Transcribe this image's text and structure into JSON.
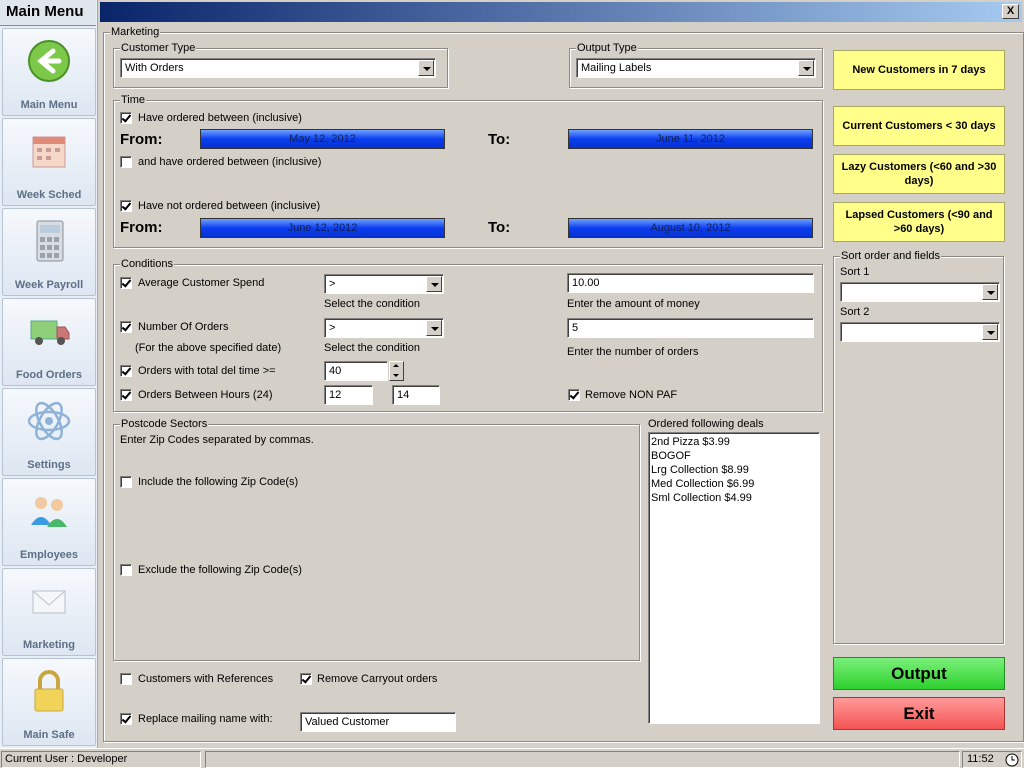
{
  "sidebar": {
    "title": "Main Menu",
    "items": [
      {
        "label": "Main Menu",
        "icon": "back-arrow-icon"
      },
      {
        "label": "Week Sched",
        "icon": "calendar-icon"
      },
      {
        "label": "Week Payroll",
        "icon": "calculator-icon"
      },
      {
        "label": "Food Orders",
        "icon": "truck-icon"
      },
      {
        "label": "Settings",
        "icon": "atom-icon"
      },
      {
        "label": "Employees",
        "icon": "people-icon"
      },
      {
        "label": "Marketing",
        "icon": "envelope-icon"
      },
      {
        "label": "Main Safe",
        "icon": "padlock-icon"
      }
    ]
  },
  "window": {
    "close_label": "X"
  },
  "marketing": {
    "label": "Marketing",
    "customer_type": {
      "label": "Customer Type",
      "value": "With Orders"
    },
    "output_type": {
      "label": "Output Type",
      "value": "Mailing Labels"
    },
    "time": {
      "label": "Time",
      "ordered_between": "Have ordered between (inclusive)",
      "from_label": "From:",
      "to_label": "To:",
      "from1": "May 12, 2012",
      "to1": "June 11, 2012",
      "and_ordered_between": "and have ordered between (inclusive)",
      "not_ordered_between": "Have not ordered between (inclusive)",
      "from2": "June 12, 2012",
      "to2": "August 10, 2012"
    },
    "conditions": {
      "label": "Conditions",
      "avg_spend": "Average Customer Spend",
      "avg_cond": ">",
      "select_condition": "Select the condition",
      "amount": "10.00",
      "amount_hint": "Enter the amount of money",
      "num_orders": "Number Of Orders",
      "num_orders_note": "(For the above specified date)",
      "num_cond": ">",
      "select_condition2": "Select the condition",
      "num_value": "5",
      "num_hint": "Enter the number of orders",
      "del_time": "Orders with total del time >=",
      "del_value": "40",
      "between_hours": "Orders Between Hours (24)",
      "hour_from": "12",
      "hour_to": "14",
      "remove_non_paf": "Remove NON PAF"
    },
    "postcode": {
      "label": "Postcode Sectors",
      "hint": "Enter Zip Codes separated by commas.",
      "include": "Include the following Zip Code(s)",
      "exclude": "Exclude the following Zip Code(s)"
    },
    "deals": {
      "label": "Ordered following deals",
      "items": [
        "2nd Pizza $3.99",
        "BOGOF",
        "Lrg Collection $8.99",
        "Med Collection $6.99",
        "Sml Collection $4.99"
      ]
    },
    "with_references": "Customers with References",
    "remove_carryout": "Remove Carryout orders",
    "replace_name": "Replace mailing name with:",
    "replace_value": "Valued Customer"
  },
  "presets": {
    "new": "New Customers        in 7 days",
    "current": "Current Customers      < 30 days",
    "lazy": "Lazy Customers       (<60 and >30 days)",
    "lapsed": "Lapsed Customers (<90 and >60 days)"
  },
  "sort": {
    "label": "Sort order and fields",
    "sort1": "Sort 1",
    "sort2": "Sort 2"
  },
  "actions": {
    "output": "Output",
    "exit": "Exit"
  },
  "status": {
    "user": "Current User : Developer",
    "time": "11:52"
  },
  "colors": {
    "output": "#33dd33",
    "exit": "#ff5a5a",
    "preset": "#ffff8a",
    "date": "#1646f0"
  }
}
